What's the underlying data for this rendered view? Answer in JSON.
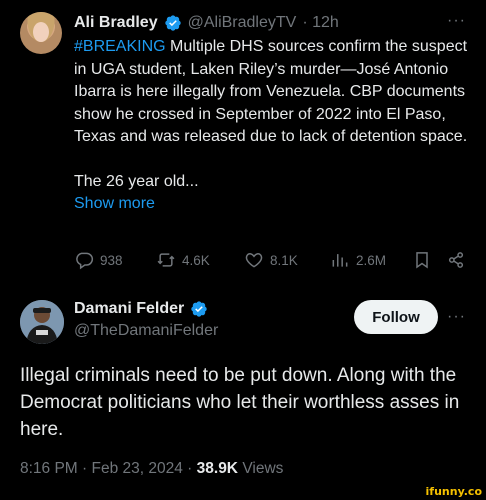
{
  "tweet1": {
    "author_name": "Ali Bradley",
    "handle": "@AliBradleyTV",
    "time": "· 12h",
    "more": "···",
    "hashtag": "#BREAKING",
    "text_after_hashtag": " Multiple DHS sources confirm the suspect in UGA student, Laken Riley’s murder—José Antonio Ibarra is here illegally from Venezuela. CBP documents show he crossed in September of 2022 into El Paso, Texas and was released due to lack of detention space.",
    "text_second": "The 26 year old...",
    "show_more": "Show more",
    "stats": {
      "replies": "938",
      "reposts": "4.6K",
      "likes": "8.1K",
      "views": "2.6M"
    }
  },
  "tweet2": {
    "author_name": "Damani Felder",
    "handle": "@TheDamaniFelder",
    "follow_label": "Follow",
    "more": "···",
    "text": "Illegal criminals need to be put down. Along with the Democrat politicians who let their worthless asses in here.",
    "time": "8:16 PM · Feb 23, 2024 ·",
    "views_count": "38.9K",
    "views_label": "Views"
  },
  "watermark": "ifunny.co",
  "colors": {
    "background": "#000000",
    "text": "#e7e9ea",
    "secondary": "#71767b",
    "accent": "#1d9bf0",
    "follow_bg": "#eff3f4"
  }
}
